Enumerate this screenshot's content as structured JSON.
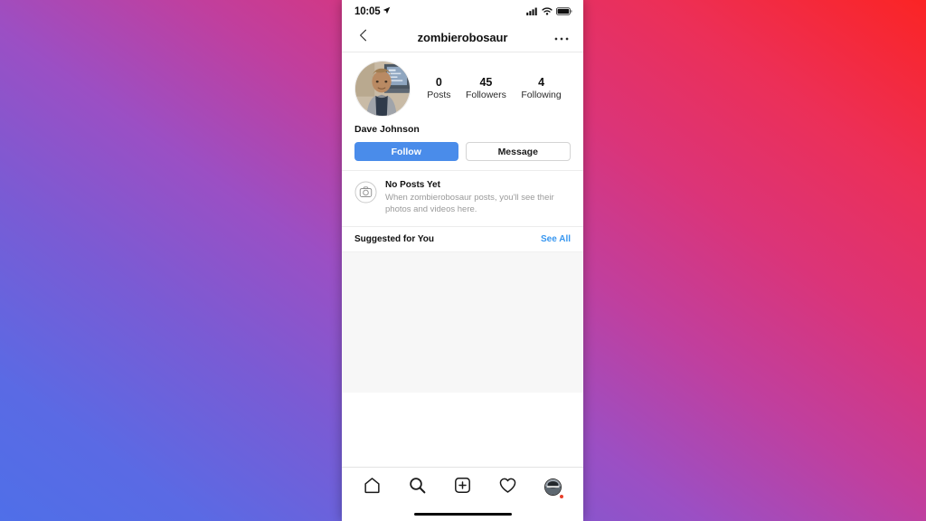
{
  "theme": {
    "accent_blue": "#3897f0",
    "follow_button_blue": "#4a8cea",
    "notification_red": "#e8402a",
    "muted_text": "#9a9a9a",
    "panel_gray": "#f7f7f7",
    "backdrop_gradient_start": "#4f6fe8",
    "backdrop_gradient_end": "#fb2424"
  },
  "status_bar": {
    "time": "10:05",
    "location_icon": "location-arrow-icon",
    "signal_icon": "cellular-signal-icon",
    "wifi_icon": "wifi-icon",
    "battery_icon": "battery-full-icon"
  },
  "header": {
    "back_icon": "chevron-left-icon",
    "title": "zombierobosaur",
    "more_icon": "more-options-icon"
  },
  "profile": {
    "avatar_alt": "profile-photo",
    "full_name": "Dave Johnson",
    "stats": [
      {
        "value": "0",
        "label": "Posts"
      },
      {
        "value": "45",
        "label": "Followers"
      },
      {
        "value": "4",
        "label": "Following"
      }
    ],
    "follow_label": "Follow",
    "message_label": "Message"
  },
  "no_posts": {
    "icon": "camera-circle-icon",
    "title": "No Posts Yet",
    "description_line1": "When zombierobosaur posts, you'll see their",
    "description_line2": "photos and videos here."
  },
  "suggested": {
    "title": "Suggested for You",
    "see_all_label": "See All"
  },
  "tab_bar": {
    "items": [
      {
        "name": "home",
        "icon": "home-icon"
      },
      {
        "name": "search",
        "icon": "search-icon"
      },
      {
        "name": "add-post",
        "icon": "plus-square-icon"
      },
      {
        "name": "activity",
        "icon": "heart-icon"
      },
      {
        "name": "profile",
        "icon": "profile-avatar-icon"
      }
    ]
  }
}
